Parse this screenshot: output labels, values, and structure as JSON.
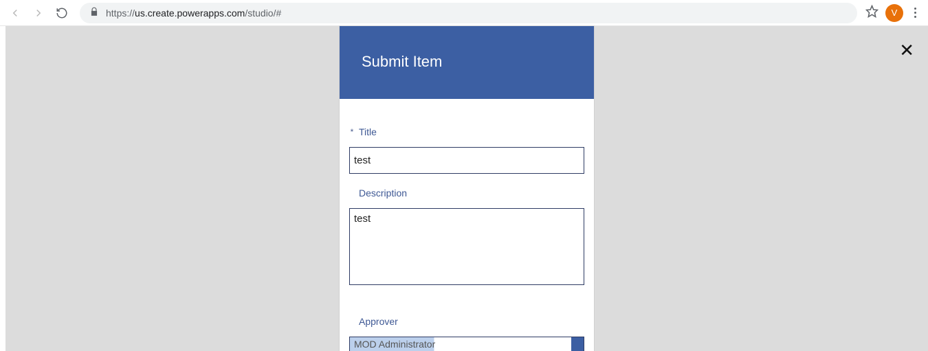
{
  "browser": {
    "url_prefix": "https://",
    "url_host": "us.create.powerapps.com",
    "url_path": "/studio/#",
    "avatar_letter": "V"
  },
  "close_label": "✕",
  "app": {
    "title": "Submit Item"
  },
  "form": {
    "title": {
      "label": "Title",
      "value": "test",
      "required_marker": "*"
    },
    "description": {
      "label": "Description",
      "value": "test"
    },
    "approver": {
      "label": "Approver",
      "value": "MOD Administrator"
    }
  }
}
